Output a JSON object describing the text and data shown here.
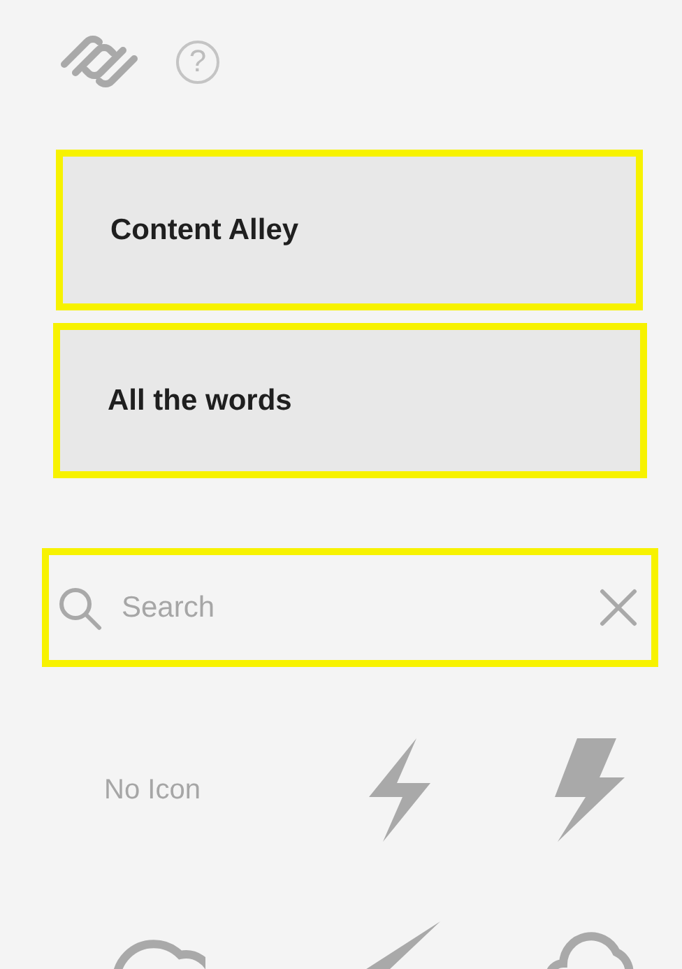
{
  "header": {
    "help_label": "?"
  },
  "cards": [
    {
      "title": "Content Alley",
      "highlighted": true
    },
    {
      "title": "All the words",
      "highlighted": true
    }
  ],
  "search": {
    "placeholder": "Search",
    "highlighted": true
  },
  "icon_grid": {
    "no_icon_label": "No Icon"
  }
}
